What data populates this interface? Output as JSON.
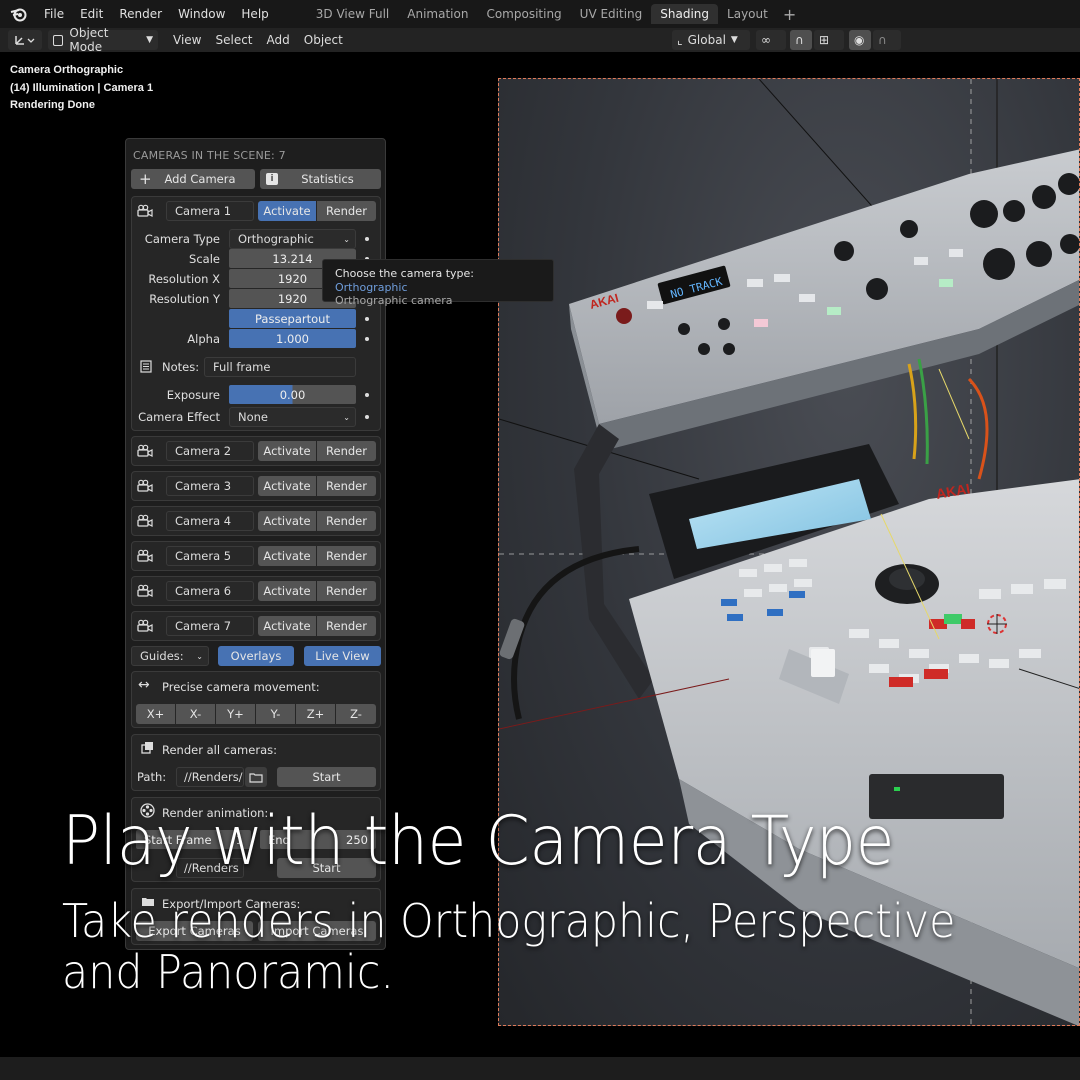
{
  "menubar": {
    "menus": [
      "File",
      "Edit",
      "Render",
      "Window",
      "Help"
    ],
    "workspaces": [
      "3D View Full",
      "Animation",
      "Compositing",
      "UV Editing",
      "Shading",
      "Layout"
    ],
    "active_workspace": "Shading"
  },
  "header": {
    "mode": "Object Mode",
    "menus": [
      "View",
      "Select",
      "Add",
      "Object"
    ],
    "orientation": "Global"
  },
  "viewport_info": {
    "line1": "Camera Orthographic",
    "line2": "(14) Illumination | Camera 1",
    "line3": "Rendering Done"
  },
  "panel": {
    "title": "CAMERAS IN THE SCENE: 7",
    "add_camera": "Add Camera",
    "statistics": "Statistics",
    "activate": "Activate",
    "render": "Render",
    "cameras": [
      "Camera 1",
      "Camera 2",
      "Camera 3",
      "Camera 4",
      "Camera 5",
      "Camera 6",
      "Camera 7"
    ],
    "camera_type_label": "Camera Type",
    "camera_type_value": "Orthographic",
    "scale_label": "Scale",
    "scale_value": "13.214",
    "res_x_label": "Resolution X",
    "res_x_value": "1920",
    "res_y_label": "Resolution Y",
    "res_y_value": "1920",
    "passepartout": "Passepartout",
    "alpha_label": "Alpha",
    "alpha_value": "1.000",
    "notes_label": "Notes:",
    "notes_value": "Full frame",
    "exposure_label": "Exposure",
    "exposure_value": "0.00",
    "effect_label": "Camera Effect",
    "effect_value": "None",
    "guides_label": "Guides:",
    "overlays": "Overlays",
    "live_view": "Live View",
    "precise_label": "Precise camera movement:",
    "axes": [
      "X+",
      "X-",
      "Y+",
      "Y-",
      "Z+",
      "Z-"
    ],
    "render_all_label": "Render all cameras:",
    "path_label": "Path:",
    "path_value": "//Renders/",
    "start": "Start",
    "render_anim_label": "Render animation:",
    "start_frame_label": "Start Frame",
    "start_frame_value": "1",
    "end_frame_label": "End",
    "end_frame_value": "250",
    "anim_path_value": "//Renders",
    "export_import_label": "Export/Import Cameras:",
    "export_label": "Export Cameras",
    "import_label": "Import Cameras"
  },
  "tooltip": {
    "prefix": "Choose the camera type: ",
    "value": "Orthographic",
    "sub": "Orthographic camera"
  },
  "headline": {
    "title": "Play with the Camera Type",
    "subtitle": "Take renders in Orthographic, Perspective and Panoramic."
  },
  "device_labels": {
    "akai_top": "AKAI",
    "display_top": "NO TRACK",
    "akai_bottom": "AKAI"
  }
}
